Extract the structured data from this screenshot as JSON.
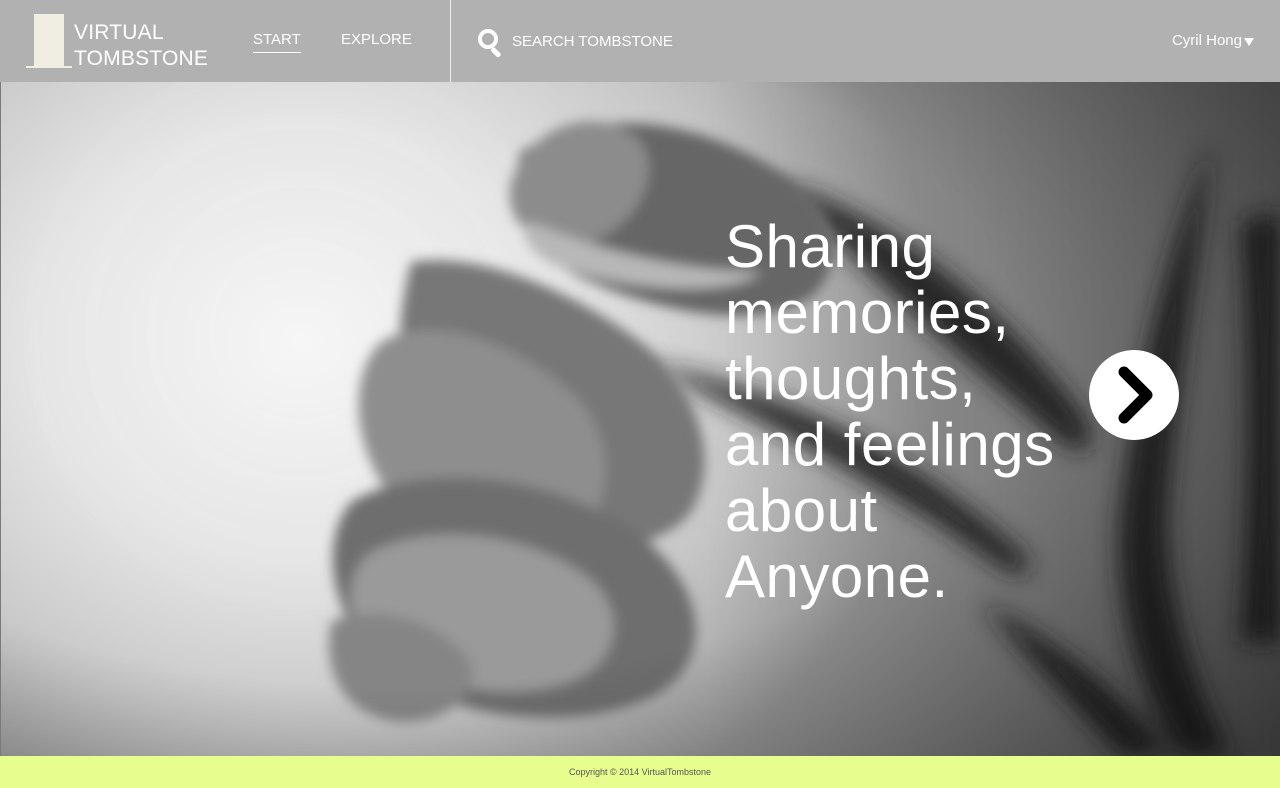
{
  "app": {
    "logo_line1": "VIRTUAL",
    "logo_line2": "TOMBSTONE"
  },
  "nav": {
    "items": [
      {
        "label": "START",
        "active": true
      },
      {
        "label": "EXPLORE",
        "active": false
      }
    ]
  },
  "search": {
    "placeholder": "SEARCH TOMBSTONE",
    "icon": "search-icon"
  },
  "user": {
    "name": "Cyril Hong",
    "icon": "caret-down-icon"
  },
  "hero": {
    "tagline_lines": [
      "Sharing",
      "memories,",
      "thoughts,",
      "and feelings",
      "about",
      "Anyone."
    ],
    "next_icon": "chevron-right-icon"
  },
  "footer": {
    "copyright": "Copyright © 2014 VirtualTombstone"
  },
  "colors": {
    "header_bg": "#b1b1b1",
    "logo_mark": "#f0ede3",
    "footer_bg": "#e7fe8e",
    "text_light": "#ffffff"
  }
}
